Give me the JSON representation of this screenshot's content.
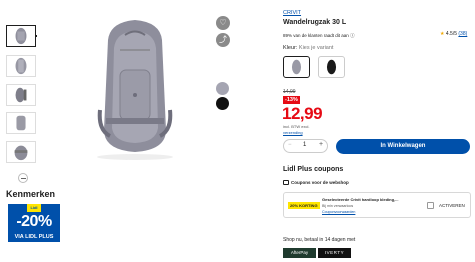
{
  "product": {
    "brand": "CRIVIT",
    "title": "Wandelrugzak 30 L",
    "rating_text": "89% van de klanten raadt dit aan",
    "rating_info_icon": "info-icon",
    "rating_value": "4.5/5",
    "rating_count": "(38)",
    "color_label": "Kleur:",
    "color_hint": "Kies je variant",
    "variants": [
      "grey",
      "black"
    ]
  },
  "pricing": {
    "old_price": "14,99",
    "discount": "-13%",
    "price": "12,99",
    "vat": "incl. BTW excl.",
    "shipping_link": "verzending"
  },
  "cart": {
    "minus": "−",
    "quantity": "1",
    "plus": "+",
    "button": "In Winkelwagen"
  },
  "left": {
    "kenmerken": "Kenmerken",
    "badge_plus": "Lidl Plus",
    "badge_pct": "-20%",
    "badge_via": "VIA LIDL PLUS"
  },
  "coupons": {
    "heading": "Lidl Plus coupons",
    "sub": "Coupons voor de webshop",
    "tag": "20% KORTING",
    "line1": "Geselecteerde Crivit hardloop kleding,...",
    "line2": "Bij min verwaarloos",
    "line3": "Couponvoorwaarden",
    "activate": "ACTIVEREN"
  },
  "payment": {
    "label": "Shop nu, betaal in 14 dagen met",
    "methods": [
      "AfterPay",
      "IVERTY"
    ]
  },
  "colors": {
    "lidl_blue": "#0050aa",
    "price_red": "#e60a14",
    "lidl_yellow": "#ffe500",
    "star": "#f2a900"
  }
}
